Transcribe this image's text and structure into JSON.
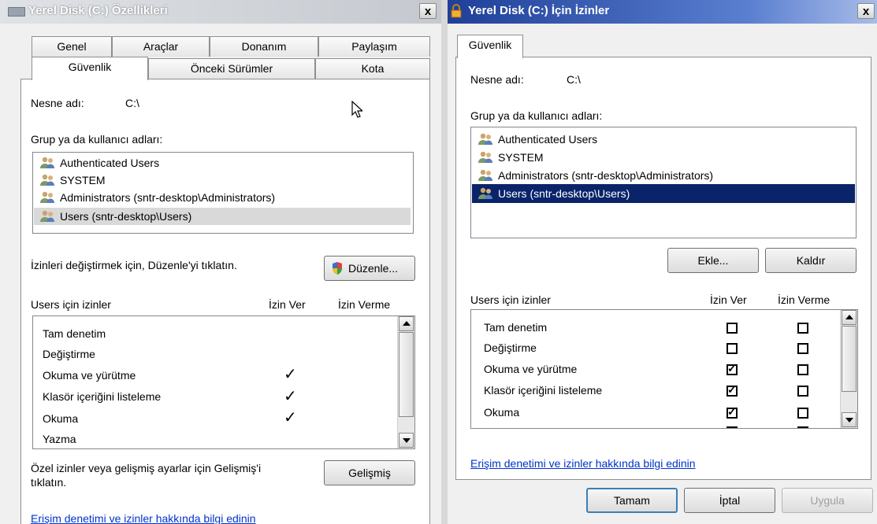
{
  "left_dialog": {
    "title": "Yerel Disk (C:) Özellikleri",
    "close_label": "x",
    "tabs_row1": [
      "Genel",
      "Araçlar",
      "Donanım",
      "Paylaşım"
    ],
    "tabs_row2": [
      "Güvenlik",
      "Önceki Sürümler",
      "Kota"
    ],
    "object_name_label": "Nesne adı:",
    "object_name_value": "C:\\",
    "groups_label": "Grup ya da kullanıcı adları:",
    "users": [
      "Authenticated Users",
      "SYSTEM",
      "Administrators (sntr-desktop\\Administrators)",
      "Users (sntr-desktop\\Users)"
    ],
    "edit_hint": "İzinleri değiştirmek için, Düzenle'yi tıklatın.",
    "edit_button": "Düzenle...",
    "perm_header": "Users için izinler",
    "allow_header": "İzin Ver",
    "deny_header": "İzin Verme",
    "permissions": [
      {
        "name": "Tam denetim",
        "allow": false
      },
      {
        "name": "Değiştirme",
        "allow": false
      },
      {
        "name": "Okuma ve yürütme",
        "allow": true
      },
      {
        "name": "Klasör içeriğini listeleme",
        "allow": true
      },
      {
        "name": "Okuma",
        "allow": true
      },
      {
        "name": "Yazma",
        "allow": false
      }
    ],
    "advanced_hint_1": "Özel izinler veya gelişmiş ayarlar için Gelişmiş'i",
    "advanced_hint_2": "tıklatın.",
    "advanced_button": "Gelişmiş",
    "help_link": "Erişim denetimi ve izinler hakkında bilgi edinin"
  },
  "right_dialog": {
    "title": "Yerel Disk (C:) İçin İzinler",
    "close_label": "x",
    "tab": "Güvenlik",
    "object_name_label": "Nesne adı:",
    "object_name_value": "C:\\",
    "groups_label": "Grup ya da kullanıcı adları:",
    "users": [
      "Authenticated Users",
      "SYSTEM",
      "Administrators (sntr-desktop\\Administrators)",
      "Users (sntr-desktop\\Users)"
    ],
    "add_button": "Ekle...",
    "remove_button": "Kaldır",
    "perm_header": "Users için izinler",
    "allow_header": "İzin Ver",
    "deny_header": "İzin Verme",
    "permissions": [
      {
        "name": "Tam denetim",
        "allow": false,
        "deny": false
      },
      {
        "name": "Değiştirme",
        "allow": false,
        "deny": false
      },
      {
        "name": "Okuma ve yürütme",
        "allow": true,
        "deny": false
      },
      {
        "name": "Klasör içeriğini listeleme",
        "allow": true,
        "deny": false
      },
      {
        "name": "Okuma",
        "allow": true,
        "deny": false
      }
    ],
    "help_link": "Erişim denetimi ve izinler hakkında bilgi edinin",
    "ok_button": "Tamam",
    "cancel_button": "İptal",
    "apply_button": "Uygula"
  },
  "colors": {
    "left_titlebar": "#c8ccd2",
    "right_titlebar": "#2a4ea8",
    "selection_blue": "#0a246a",
    "link": "#0033cc"
  }
}
